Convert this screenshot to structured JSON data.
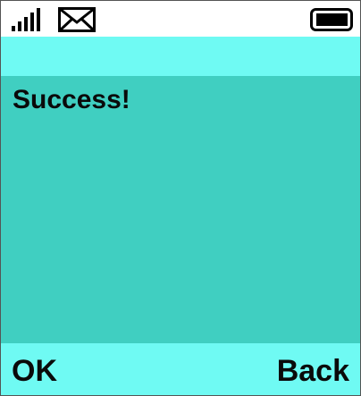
{
  "status_bar": {
    "icons": [
      "signal-strength-icon",
      "mail-icon",
      "battery-icon"
    ],
    "background": "#ffffff"
  },
  "colors": {
    "header_band": "#6ffaf3",
    "content": "#40cfc1",
    "softkey_bar": "#6ffaf3",
    "text": "#0a0a0a"
  },
  "content": {
    "message": "Success!"
  },
  "softkeys": {
    "left_label": "OK",
    "right_label": "Back"
  }
}
